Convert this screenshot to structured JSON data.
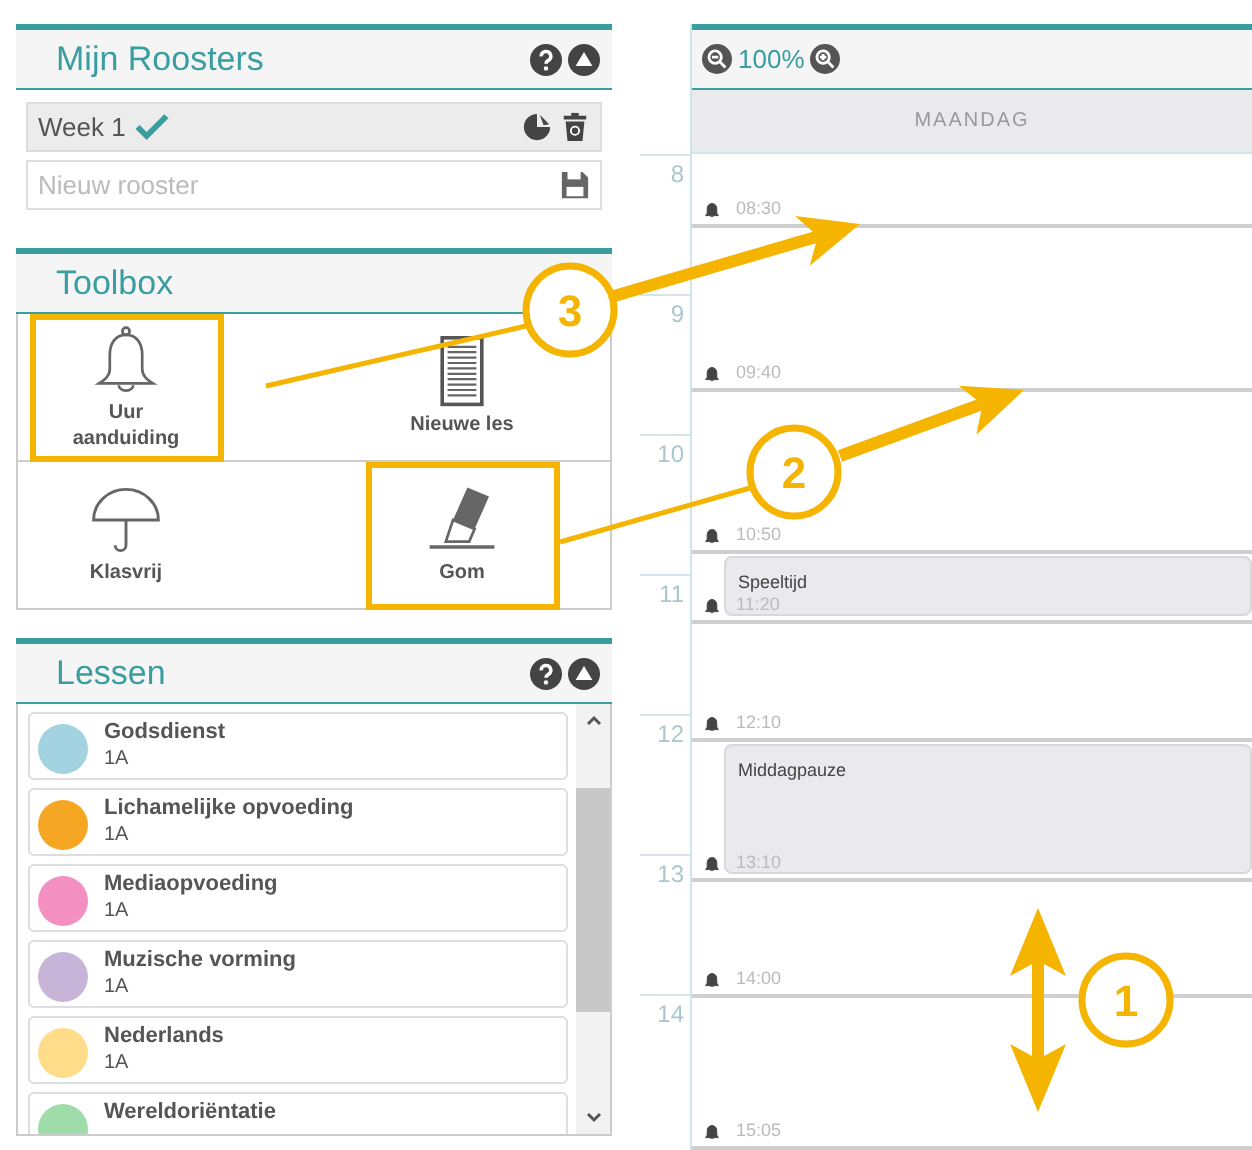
{
  "schedules_panel": {
    "title": "Mijn Roosters",
    "schedules": [
      {
        "name": "Week 1",
        "selected": true
      }
    ],
    "new_schedule": {
      "placeholder": "Nieuw rooster"
    }
  },
  "toolbox": {
    "title": "Toolbox",
    "tools": [
      {
        "kind": "bell",
        "label": "Uur aanduiding",
        "highlighted": true
      },
      {
        "kind": "document",
        "label": "Nieuwe les",
        "highlighted": false
      },
      {
        "kind": "umbrella",
        "label": "Klasvrij",
        "highlighted": false
      },
      {
        "kind": "eraser",
        "label": "Gom",
        "highlighted": true
      }
    ]
  },
  "lessons_panel": {
    "title": "Lessen",
    "lessons": [
      {
        "name": "Godsdienst",
        "class": "1A",
        "color": "#a3d3e0"
      },
      {
        "name": "Lichamelijke opvoeding",
        "class": "1A",
        "color": "#f5a623"
      },
      {
        "name": "Mediaopvoeding",
        "class": "1A",
        "color": "#f48fc1"
      },
      {
        "name": "Muzische vorming",
        "class": "1A",
        "color": "#c7b5d9"
      },
      {
        "name": "Nederlands",
        "class": "1A",
        "color": "#fedc8a"
      },
      {
        "name": "Wereldoriëntatie",
        "color": "#9fdcaa"
      }
    ]
  },
  "calendar": {
    "zoom": "100%",
    "day": "MAANDAG",
    "hours": [
      "8",
      "9",
      "10",
      "11",
      "12",
      "13",
      "14"
    ],
    "markers": [
      {
        "time": "08:30"
      },
      {
        "time": "09:40"
      },
      {
        "time": "10:50"
      },
      {
        "time": "11:20",
        "block": "Speeltijd"
      },
      {
        "time": "12:10"
      },
      {
        "time": "13:10",
        "block": "Middagpauze"
      },
      {
        "time": "14:00"
      },
      {
        "time": "15:05"
      }
    ]
  },
  "callouts": [
    {
      "number": "3"
    },
    {
      "number": "2"
    },
    {
      "number": "1"
    }
  ]
}
